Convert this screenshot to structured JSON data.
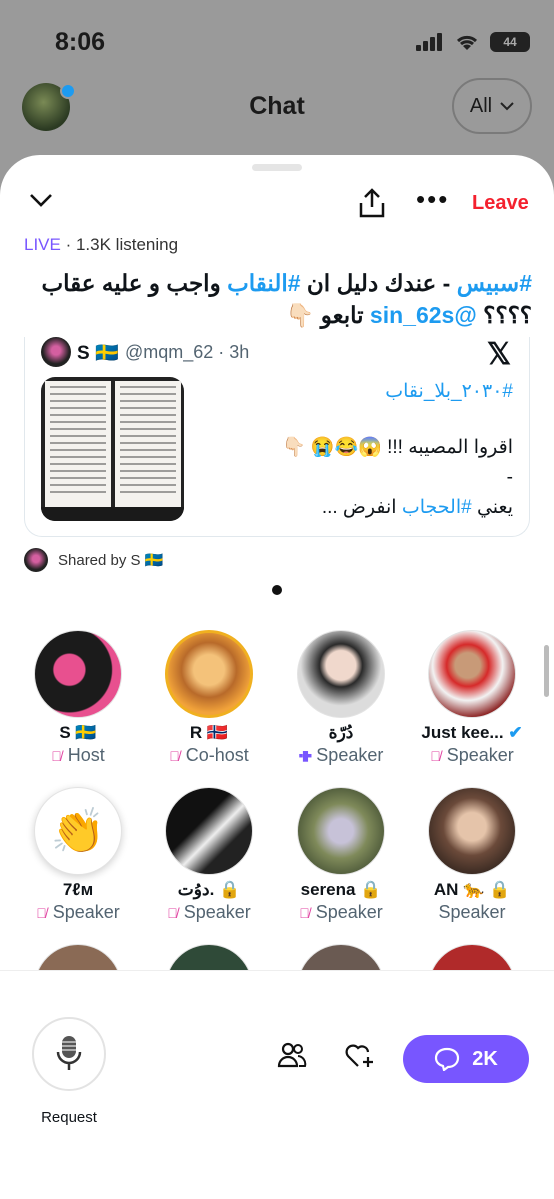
{
  "status": {
    "time": "8:06",
    "battery": "44"
  },
  "background": {
    "title": "Chat",
    "filter": "All"
  },
  "space": {
    "leave": "Leave",
    "live": "LIVE",
    "listening": " · 1.3K listening",
    "title_hashtag1": "#سبيس",
    "title_part1": " - عندك دليل ان ",
    "title_hashtag2": "#النقاب",
    "title_part2": " واجب و عليه عقاب ؟؟؟؟ ",
    "title_mention": "@sin_62s",
    "title_part3": " تابعو 👇🏻"
  },
  "tweet": {
    "name": "S 🇸🇪",
    "handle": "@mqm_62 · 3h",
    "hashtag": "#٢٠٣٠_بلا_نقاب",
    "line2": "اقروا المصيبه !!! 😱😂😭 👇🏻",
    "line3": "-",
    "line4_a": "يعني ",
    "line4_tag": "#الحجاب",
    "line4_b": " انفرض ..."
  },
  "shared_by": "Shared by S 🇸🇪",
  "participants": [
    {
      "name": "S 🇸🇪",
      "role": "Host",
      "muted": true
    },
    {
      "name": "R 🇳🇴",
      "role": "Co-host",
      "muted": true
    },
    {
      "name": "دُرّة",
      "role": "Speaker",
      "muted": false
    },
    {
      "name": "Just kee...",
      "role": "Speaker",
      "muted": true
    },
    {
      "name": "7ℓм",
      "role": "Speaker",
      "muted": true
    },
    {
      "name": "دوُت. 🔒",
      "role": "Speaker",
      "muted": true
    },
    {
      "name": "serena 🔒",
      "role": "Speaker",
      "muted": true
    },
    {
      "name": "AN 🐆 🔒",
      "role": "Speaker",
      "muted": false
    }
  ],
  "bottom": {
    "request": "Request",
    "chat_count": "2K"
  },
  "colors": {
    "accent": "#7856ff",
    "link": "#1d9bf0",
    "leave": "#f4212e",
    "muted_mic": "#e040a0"
  }
}
